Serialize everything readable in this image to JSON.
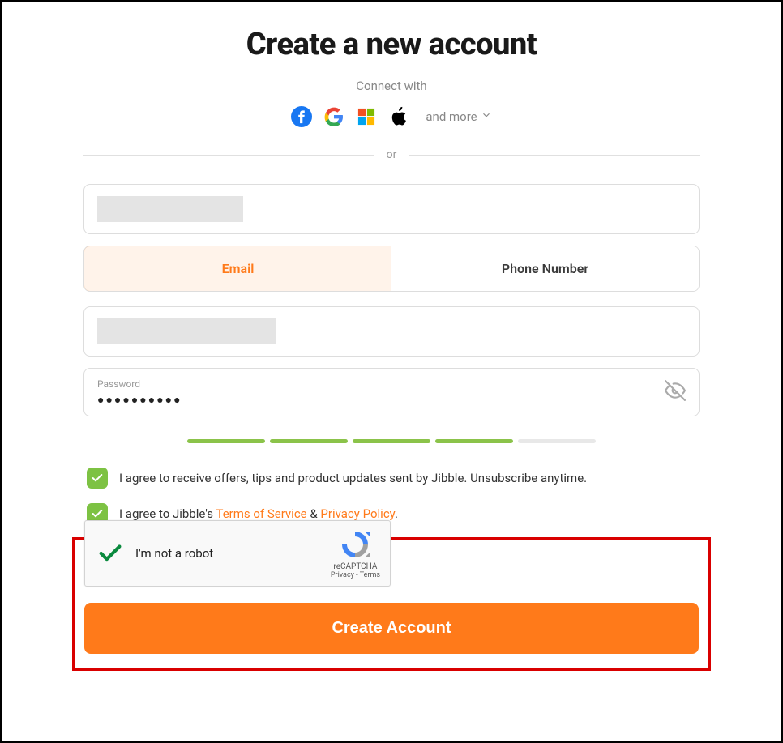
{
  "title": "Create a new account",
  "connect": {
    "label": "Connect with",
    "more": "and more"
  },
  "divider": "or",
  "tabs": {
    "email": "Email",
    "phone": "Phone Number"
  },
  "password": {
    "label": "Password",
    "masked": "●●●●●●●●●●"
  },
  "checks": {
    "offers": "I agree to receive offers, tips and product updates sent by Jibble. Unsubscribe anytime.",
    "terms_prefix": "I agree to Jibble's ",
    "tos": "Terms of Service",
    "amp": " & ",
    "privacy": "Privacy Policy",
    "period": "."
  },
  "recaptcha": {
    "text": "I'm not a robot",
    "brand": "reCAPTCHA",
    "privacy": "Privacy",
    "sep": " - ",
    "terms": "Terms"
  },
  "submit": "Create Account"
}
